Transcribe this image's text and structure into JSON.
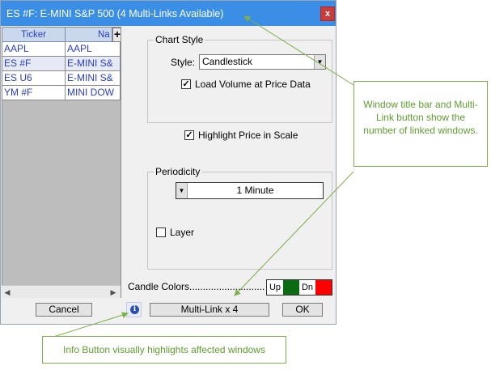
{
  "window": {
    "title": "ES #F: E-MINI S&P 500 (4 Multi-Links Available)",
    "close_label": "x"
  },
  "grid": {
    "columns": [
      "Ticker",
      "Na"
    ],
    "add_label": "+",
    "rows": [
      {
        "ticker": "AAPL",
        "name": "AAPL"
      },
      {
        "ticker": "ES #F",
        "name": "E-MINI S&"
      },
      {
        "ticker": "ES U6",
        "name": "E-MINI S&"
      },
      {
        "ticker": "YM #F",
        "name": "MINI DOW"
      }
    ],
    "scroll_left": "◀",
    "scroll_right": "▶"
  },
  "chart_style": {
    "group_title": "Chart Style",
    "style_label": "Style:",
    "style_value": "Candlestick",
    "load_volume_checked": true,
    "load_volume_label": "Load Volume at Price Data"
  },
  "highlight_price": {
    "checked": true,
    "label": "Highlight Price in Scale"
  },
  "periodicity": {
    "group_title": "Periodicity",
    "value": "1 Minute",
    "layer_checked": false,
    "layer_label": "Layer"
  },
  "candle_colors": {
    "label": "Candle Colors............................",
    "up_label": "Up",
    "up_color": "#0a6b12",
    "down_label": "Dn",
    "down_color": "#ff0000"
  },
  "buttons": {
    "cancel": "Cancel",
    "info": "i",
    "multilink": "Multi-Link x 4",
    "ok": "OK"
  },
  "callouts": {
    "title_bar_note": "Window title bar and Multi-Link button show the number of linked windows.",
    "info_note": "Info Button visually highlights affected windows"
  },
  "colors": {
    "title_bar": "#3a8ee6",
    "callout_border": "#7db04a",
    "callout_text": "#5e9e2e",
    "link_text": "#2b3fc6"
  }
}
